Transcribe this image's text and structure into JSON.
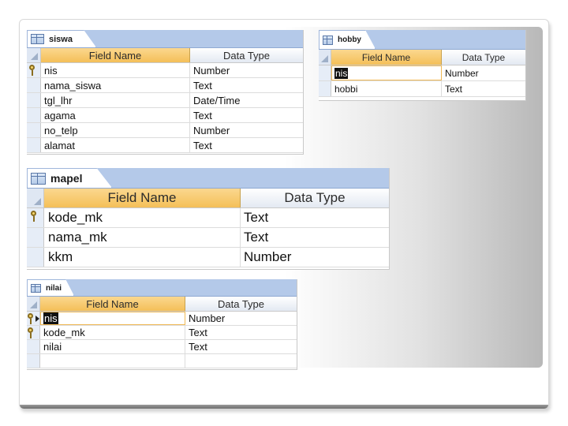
{
  "tables": {
    "siswa": {
      "name": "siswa",
      "header": {
        "field_name": "Field Name",
        "data_type": "Data Type"
      },
      "rows": [
        {
          "field": "nis",
          "type": "Number",
          "key": true
        },
        {
          "field": "nama_siswa",
          "type": "Text"
        },
        {
          "field": "tgl_lhr",
          "type": "Date/Time"
        },
        {
          "field": "agama",
          "type": "Text"
        },
        {
          "field": "no_telp",
          "type": "Number"
        },
        {
          "field": "alamat",
          "type": "Text"
        }
      ]
    },
    "hobby": {
      "name": "hobby",
      "header": {
        "field_name": "Field Name",
        "data_type": "Data Type"
      },
      "rows": [
        {
          "field": "nis",
          "type": "Number",
          "selected": true
        },
        {
          "field": "hobbi",
          "type": "Text"
        }
      ]
    },
    "mapel": {
      "name": "mapel",
      "header": {
        "field_name": "Field Name",
        "data_type": "Data Type"
      },
      "rows": [
        {
          "field": "kode_mk",
          "type": "Text",
          "key": true
        },
        {
          "field": "nama_mk",
          "type": "Text"
        },
        {
          "field": "kkm",
          "type": "Number"
        }
      ]
    },
    "nilai": {
      "name": "nilai",
      "header": {
        "field_name": "Field Name",
        "data_type": "Data Type"
      },
      "rows": [
        {
          "field": "nis",
          "type": "Number",
          "key": true,
          "selected": true,
          "current": true
        },
        {
          "field": "kode_mk",
          "type": "Text",
          "key": true
        },
        {
          "field": "nilai",
          "type": "Text"
        },
        {
          "field": "",
          "type": ""
        }
      ]
    }
  },
  "icons": {
    "primary_key": "key-icon",
    "current_row": "arrow-right-icon",
    "table": "table-icon"
  }
}
